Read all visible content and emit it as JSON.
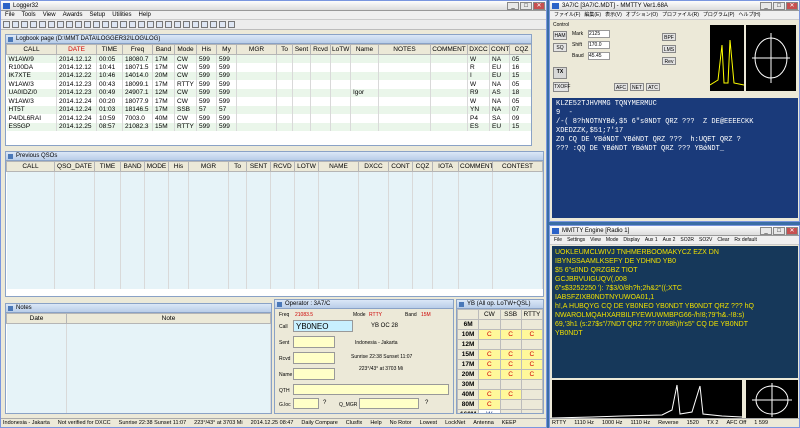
{
  "logger": {
    "title": "Logger32",
    "menu": [
      "File",
      "Tools",
      "View",
      "Awards",
      "Setup",
      "Utilities",
      "Help"
    ],
    "logbook_title": "Logbook page (D:\\MMT DATA\\LOGGER32\\LOG\\LOG)",
    "log_columns": [
      "CALL",
      "DATE",
      "TIME",
      "Freq",
      "Band",
      "Mode",
      "His",
      "My",
      "MGR",
      "To",
      "Sent",
      "Rcvd",
      "LoTW",
      "Name",
      "NOTES",
      "COMMENT",
      "DXCC",
      "CONT",
      "CQZ"
    ],
    "log_rows": [
      [
        "W1AW/9",
        "2014.12.12",
        "00:05",
        "18080.7",
        "17M",
        "CW",
        "599",
        "599",
        "",
        "",
        "",
        "",
        "",
        "",
        "",
        "",
        "W",
        "NA",
        "05"
      ],
      [
        "R100DA",
        "2014.12.12",
        "10:41",
        "18071.5",
        "17M",
        "CW",
        "599",
        "599",
        "",
        "",
        "",
        "",
        "",
        "",
        "",
        "",
        "R",
        "EU",
        "16"
      ],
      [
        "IK7XTE",
        "2014.12.22",
        "10:46",
        "14014.0",
        "20M",
        "CW",
        "599",
        "599",
        "",
        "",
        "",
        "",
        "",
        "",
        "",
        "",
        "I",
        "EU",
        "15"
      ],
      [
        "W1AW/3",
        "2014.12.23",
        "00:43",
        "18099.1",
        "17M",
        "RTTY",
        "599",
        "599",
        "",
        "",
        "",
        "",
        "",
        "",
        "",
        "",
        "W",
        "NA",
        "05"
      ],
      [
        "UA0IDZ/0",
        "2014.12.23",
        "00:49",
        "24907.1",
        "12M",
        "CW",
        "599",
        "599",
        "",
        "",
        "",
        "",
        "",
        "Igor",
        "",
        "",
        "R9",
        "AS",
        "18"
      ],
      [
        "W1AW/3",
        "2014.12.24",
        "00:20",
        "18077.9",
        "17M",
        "CW",
        "599",
        "599",
        "",
        "",
        "",
        "",
        "",
        "",
        "",
        "",
        "W",
        "NA",
        "05"
      ],
      [
        "HT5T",
        "2014.12.24",
        "01:03",
        "18146.5",
        "17M",
        "SSB",
        "57",
        "57",
        "",
        "",
        "",
        "",
        "",
        "",
        "",
        "",
        "YN",
        "NA",
        "07"
      ],
      [
        "P4/DL6RAI",
        "2014.12.24",
        "10:59",
        "7003.0",
        "40M",
        "CW",
        "599",
        "599",
        "",
        "",
        "",
        "",
        "",
        "",
        "",
        "",
        "P4",
        "SA",
        "09"
      ],
      [
        "ES5GP",
        "2014.12.25",
        "08:57",
        "21082.3",
        "15M",
        "RTTY",
        "599",
        "599",
        "",
        "",
        "",
        "",
        "",
        "",
        "",
        "",
        "ES",
        "EU",
        "15"
      ]
    ],
    "prev_title": "Previous QSOs",
    "prev_columns": [
      "CALL",
      "QSO_DATE",
      "TIME",
      "BAND",
      "MODE",
      "His",
      "MGR",
      "To",
      "SENT",
      "RCVD",
      "LOTW",
      "NAME",
      "DXCC",
      "CONT",
      "CQZ",
      "IOTA",
      "COMMENT",
      "CONTEST",
      "S"
    ],
    "notes_title": "Notes",
    "notes_columns": [
      "Date",
      "Note"
    ],
    "operator": {
      "title": "Operator : 3A7/C",
      "freq_label": "Freq",
      "freq_value": "21083.5",
      "mode_label": "Mode",
      "mode_value": "RTTY",
      "band_label": "Band",
      "band_value": "15M",
      "call_label": "Call",
      "call_value": "YB0NEO",
      "zone_text": "YB  OC  28",
      "sent_label": "Sent",
      "rcvd_label": "Rcvd",
      "name_label": "Name",
      "qth_label": "QTH",
      "grid_label": "G.loc",
      "qmgr_label": "Q_MGR",
      "country": "Indonesia - Jakarta",
      "sun": "Sunrise 22:38  Sunset 11:07",
      "bearing": "223°/43°  at 3703 Mi",
      "help_q": "?"
    },
    "bands": {
      "title": "YB (All op. LoTW+QSL)",
      "columns": [
        "",
        "CW",
        "SSB",
        "RTTY"
      ],
      "rows": [
        [
          "6M",
          "",
          "",
          ""
        ],
        [
          "10M",
          "C",
          "C",
          "C"
        ],
        [
          "12M",
          "",
          "",
          ""
        ],
        [
          "15M",
          "C",
          "C",
          "C"
        ],
        [
          "17M",
          "C",
          "C",
          "C"
        ],
        [
          "20M",
          "C",
          "C",
          "C"
        ],
        [
          "30M",
          "",
          "",
          ""
        ],
        [
          "40M",
          "C",
          "C",
          ""
        ],
        [
          "80M",
          "C",
          "",
          ""
        ],
        [
          "160M",
          "W",
          "",
          ""
        ]
      ]
    },
    "status": [
      "Indonesia - Jakarta",
      "Not verified for DXCC",
      "Sunrise 22:38 Sunset 11:07",
      "223°/43° at 3703 Mi",
      "2014.12.25  08:47",
      "Daily Compare",
      "Clusfix",
      "Help",
      "No Rotor",
      "Lowest",
      "LockNet",
      "Antenna",
      "KEEP"
    ]
  },
  "mmtty": {
    "title": "3A7/C [3A7/C.MDT] - MMTTY Ver1.68A",
    "menu": [
      "ファイル(F)",
      "編集(E)",
      "表示(V)",
      "オプション(O)",
      "プロファイル(R)",
      "プログラム(P)",
      "ヘルプ(H)"
    ],
    "rx_lines": [
      "KLZE52TJHVMMG TQNYMERMUC",
      "9  -",
      "/-( 8?hNOTNYBǿ,$5 6\"s0NDT QRZ ???  Z DE@EEEECKK",
      "XDEDZZK,$51;7'17",
      "ZO CQ DE YBǿNDT YBǿNDT QRZ ???  h:UQET QRZ ?",
      "??? :QQ DE YBǿNDT YBǿNDT QRZ ??? YBǿNDT_"
    ],
    "ctrl_labels": [
      "Control",
      "Mark",
      "Shift",
      "Baud",
      "HAM",
      "SQ",
      "AFC",
      "NET",
      "ATC",
      "BPF",
      "LMS",
      "Rev",
      "TX",
      "TXOFF"
    ],
    "mark": "2125",
    "shift": "170.0",
    "baud": "45.45",
    "engine_title": "MMTTY Engine [Radio 1]",
    "engine_menu": [
      "File",
      "Settings",
      "View",
      "Mode",
      "Display",
      "Aux 1",
      "Aux 2",
      "SO2R",
      "SO2V",
      "Clear",
      "Rx default"
    ],
    "engine_lines": [
      "UOKLEUMCLWIVJ TNHMERBOOMAKYCZ EZX DN",
      "IBYNSSAAMLKSEFY DE YDHND YB0",
      "$5 6\"s0ND QRZGBZ TIOT",
      "GCJBRVUIGUQV(,008",
      "6\"s$3252250 '): 7$3/0/8h?h;2h&2\"((;XTC",
      "IABSFZIXB0NDTNYUWOA01,1",
      "h!,A HUBQYG CQ DE YB0NEO YB0NDT YB0NDT QRZ ??? hQ",
      "NWAROLMQAHXARBILFYEWUWMBPG66-/h!8;79\"h&.-!8:s)",
      "69,'3h1 (s:27$s\"/7NDT QRZ ??? 0768h)h's5\" CQ DE YB0NDT",
      "YB0NDT"
    ],
    "engine_status": [
      "RTTY",
      "1110 Hz",
      "1000 Hz",
      "1110 Hz",
      "Reverse",
      "1520",
      "TX 2",
      "AFC Off",
      "1 599"
    ]
  },
  "colors": {
    "desktop": "#3a6ea5",
    "rx_bg": "#1a3a7a",
    "engine_bg": "#16385a",
    "engine_text": "#f0e000",
    "date_header": "#d00000"
  }
}
